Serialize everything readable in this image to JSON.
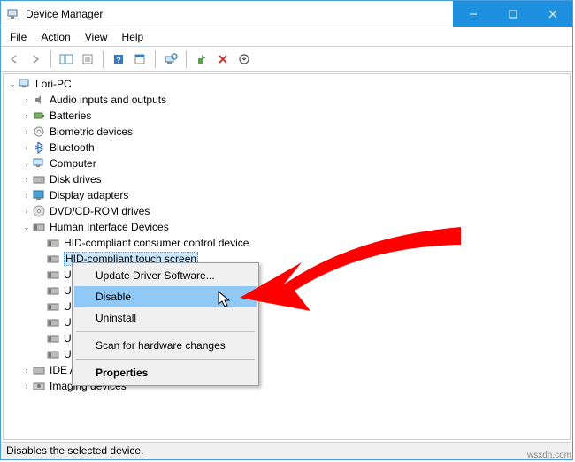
{
  "window": {
    "title": "Device Manager"
  },
  "menubar": {
    "file": "File",
    "action": "Action",
    "view": "View",
    "help": "Help"
  },
  "tree": {
    "root": "Lori-PC",
    "items": [
      "Audio inputs and outputs",
      "Batteries",
      "Biometric devices",
      "Bluetooth",
      "Computer",
      "Disk drives",
      "Display adapters",
      "DVD/CD-ROM drives",
      "Human Interface Devices",
      "IDE ATA/ATAPI controllers",
      "Imaging devices"
    ],
    "hid_children": [
      "HID-compliant consumer control device",
      "HID-compliant touch screen",
      "USB Input Device",
      "USB Input Device",
      "USB Input Device",
      "USB Input Device",
      "USB Input Device",
      "USB Input Device"
    ]
  },
  "context_menu": {
    "update": "Update Driver Software...",
    "disable": "Disable",
    "uninstall": "Uninstall",
    "scan": "Scan for hardware changes",
    "properties": "Properties"
  },
  "statusbar": {
    "text": "Disables the selected device."
  },
  "watermark": "wsxdn.com"
}
